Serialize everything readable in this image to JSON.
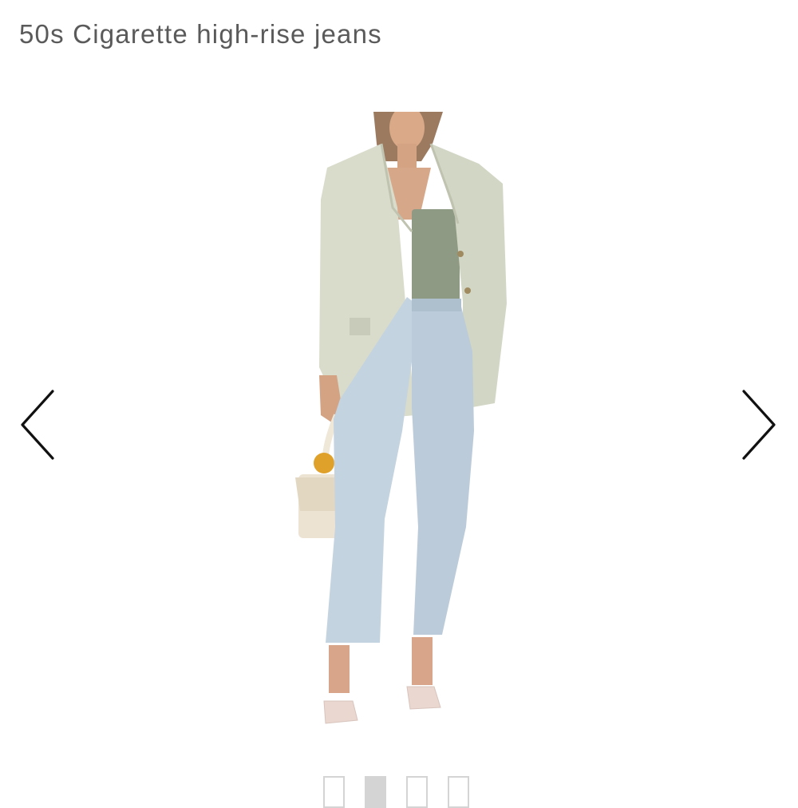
{
  "header": {
    "brand_partial": "",
    "product_title": "50s Cigarette high-rise jeans"
  },
  "gallery": {
    "prev_icon": "chevron-left-icon",
    "next_icon": "chevron-right-icon",
    "total_images": 4,
    "active_index": 1
  },
  "colors": {
    "title": "#5a5a5a",
    "dot_border": "#d4d4d4",
    "dot_active": "#d4d4d4"
  }
}
